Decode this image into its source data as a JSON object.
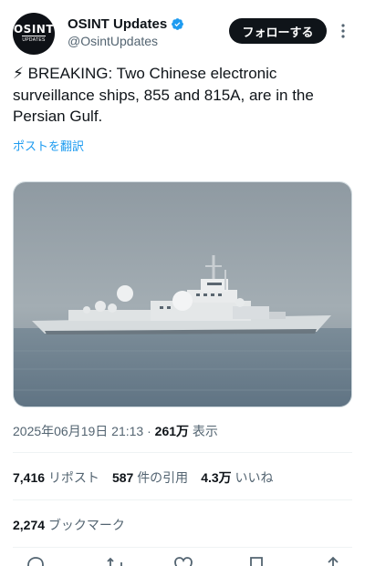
{
  "author": {
    "avatar_line1": "OSINT",
    "avatar_line2": "UPDATES",
    "display_name": "OSINT Updates",
    "handle": "@OsintUpdates",
    "verified": true
  },
  "follow_label": "フォローする",
  "tweet": {
    "text": "⚡ BREAKING: Two Chinese electronic surveillance ships, 855 and 815A, are in the Persian Gulf.",
    "translate_label": "ポストを翻訳"
  },
  "meta": {
    "timestamp": "2025年06月19日 21:13",
    "separator": " · ",
    "views_count": "261万",
    "views_label": " 表示"
  },
  "stats": [
    {
      "count": "7,416",
      "label": "リポスト"
    },
    {
      "count": "587",
      "label": "件の引用"
    },
    {
      "count": "4.3万",
      "label": "いいね"
    }
  ],
  "bookmarks": {
    "count": "2,274",
    "label": "ブックマーク"
  },
  "colors": {
    "accent": "#1d9bf0",
    "text": "#0f1419",
    "muted": "#536471",
    "button_bg": "#0f1419"
  }
}
